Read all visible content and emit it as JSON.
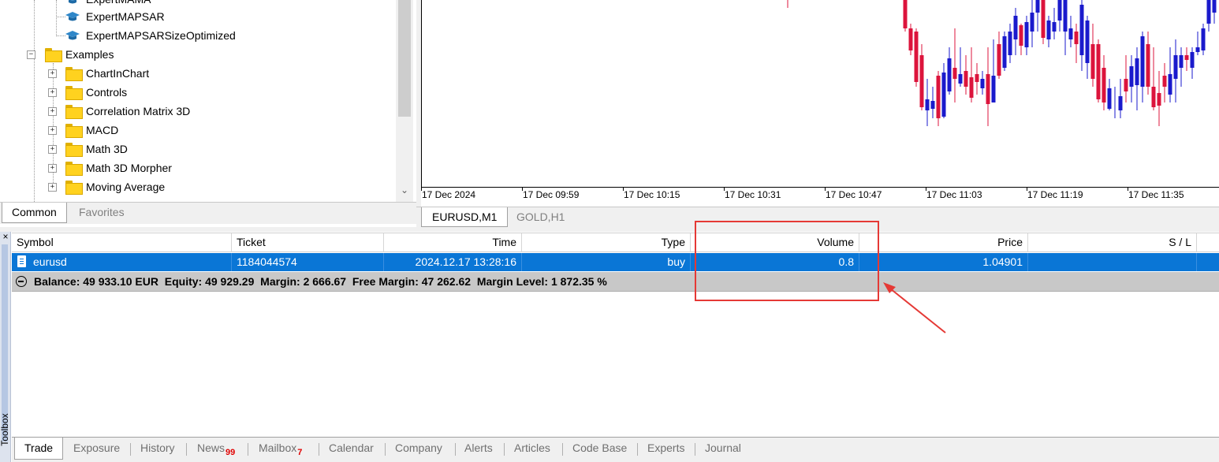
{
  "navigator": {
    "tree": {
      "expert_mama": "ExpertMAMA",
      "expert_mapsar": "ExpertMAPSAR",
      "expert_mapsar_size_optimized": "ExpertMAPSARSizeOptimized",
      "examples": "Examples",
      "example_items": [
        "ChartInChart",
        "Controls",
        "Correlation Matrix 3D",
        "MACD",
        "Math 3D",
        "Math 3D Morpher",
        "Moving Average"
      ]
    },
    "tabs": {
      "common": "Common",
      "favorites": "Favorites"
    }
  },
  "chart": {
    "x_labels": [
      "17 Dec 2024",
      "17 Dec 09:59",
      "17 Dec 10:15",
      "17 Dec 10:31",
      "17 Dec 10:47",
      "17 Dec 11:03",
      "17 Dec 11:19",
      "17 Dec 11:35"
    ],
    "tabs": {
      "eurusd": "EURUSD,M1",
      "gold": "GOLD,H1"
    },
    "colors": {
      "bull": "#1a1acc",
      "bear": "#dc143c",
      "axis": "#000000"
    }
  },
  "toolbox": {
    "label": "Toolbox",
    "close": "×",
    "columns": {
      "symbol": "Symbol",
      "ticket": "Ticket",
      "time": "Time",
      "type": "Type",
      "volume": "Volume",
      "price": "Price",
      "sl": "S / L"
    },
    "position": {
      "symbol": "eurusd",
      "ticket": "1184044574",
      "time": "2024.12.17 13:28:16",
      "type": "buy",
      "volume": "0.8",
      "price": "1.04901"
    },
    "balance_line": "Balance: 49 933.10 EUR  Equity: 49 929.29  Margin: 2 666.67  Free Margin: 47 262.62  Margin Level: 1 872.35 %",
    "tabs": {
      "trade": "Trade",
      "exposure": "Exposure",
      "history": "History",
      "news": "News",
      "news_count": "99",
      "mailbox": "Mailbox",
      "mailbox_count": "7",
      "calendar": "Calendar",
      "company": "Company",
      "alerts": "Alerts",
      "articles": "Articles",
      "code_base": "Code Base",
      "experts": "Experts",
      "journal": "Journal"
    }
  },
  "annotation": {
    "color": "#e53935"
  }
}
